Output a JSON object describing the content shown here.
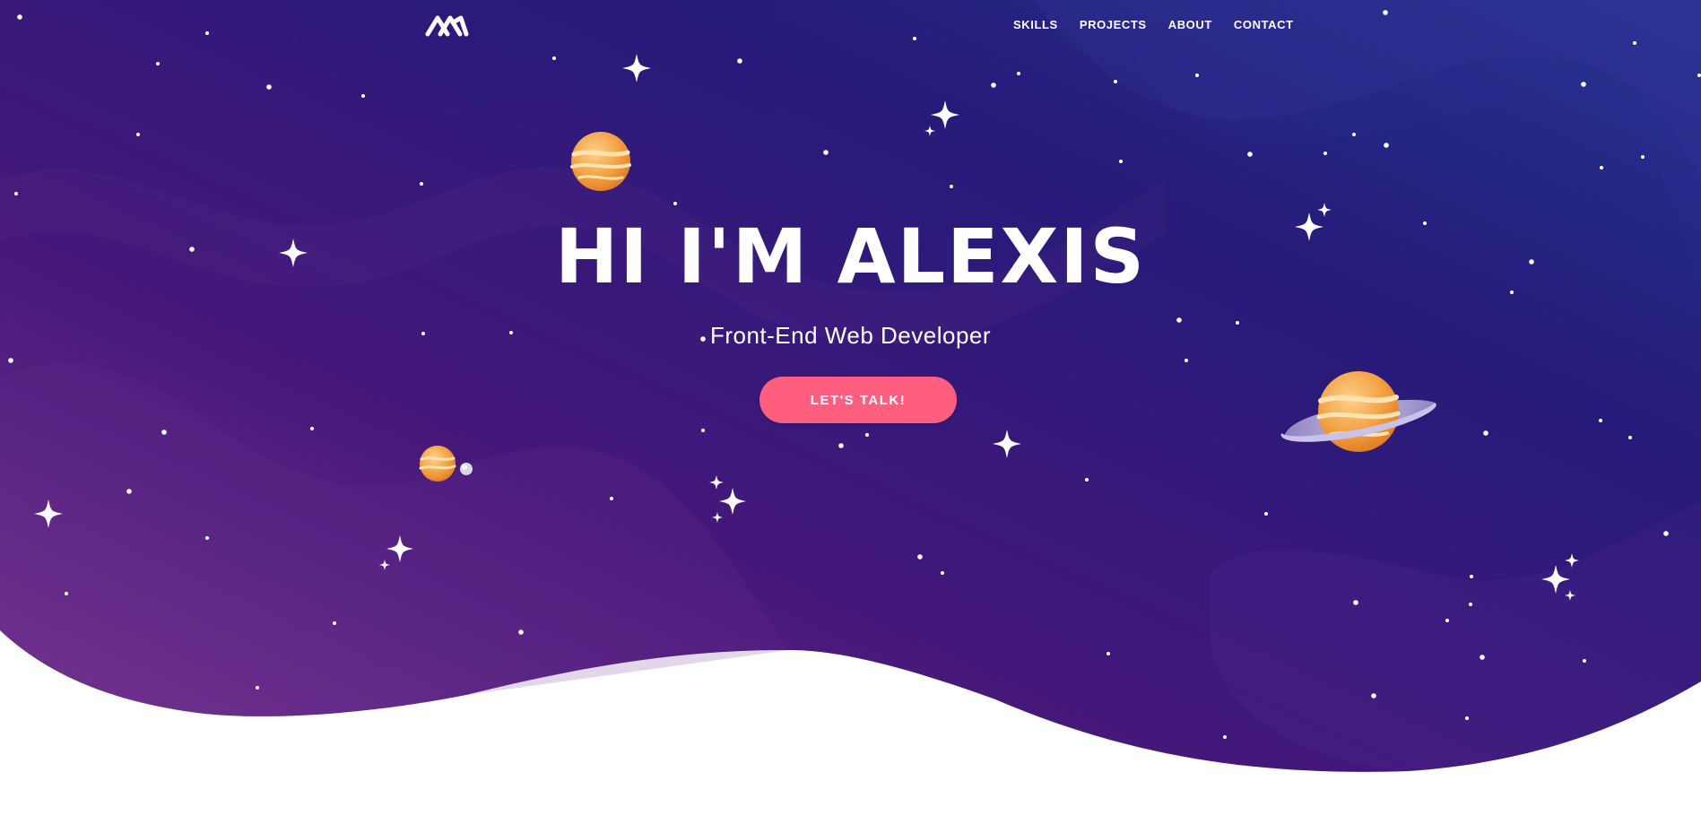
{
  "brand": {
    "logo_icon": "mountain-logo-icon"
  },
  "nav": {
    "items": [
      {
        "label": "SKILLS"
      },
      {
        "label": "PROJECTS"
      },
      {
        "label": "ABOUT"
      },
      {
        "label": "CONTACT"
      }
    ]
  },
  "hero": {
    "title": "HI I'M ALEXIS",
    "subtitle": "Front-End Web Developer",
    "cta_label": "LET'S TALK!"
  },
  "colors": {
    "sky_dark": "#22197a",
    "sky_purple": "#4a1c7a",
    "accent_pink": "#ff5e7e",
    "planet_orange": "#f3a042",
    "text_white": "#ffffff"
  }
}
